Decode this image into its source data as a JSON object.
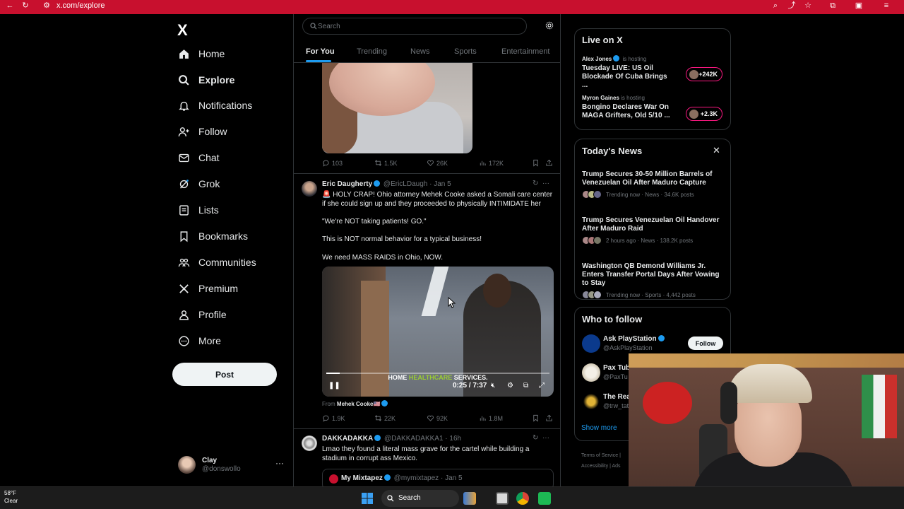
{
  "browser": {
    "url": "x.com/explore"
  },
  "nav": {
    "logo": "X",
    "items": [
      {
        "label": "Home",
        "icon": "home-icon"
      },
      {
        "label": "Explore",
        "icon": "search-icon"
      },
      {
        "label": "Notifications",
        "icon": "bell-icon"
      },
      {
        "label": "Follow",
        "icon": "person-add-icon"
      },
      {
        "label": "Chat",
        "icon": "envelope-icon"
      },
      {
        "label": "Grok",
        "icon": "grok-icon"
      },
      {
        "label": "Lists",
        "icon": "list-icon"
      },
      {
        "label": "Bookmarks",
        "icon": "bookmark-icon"
      },
      {
        "label": "Communities",
        "icon": "people-icon"
      },
      {
        "label": "Premium",
        "icon": "x-logo-icon"
      },
      {
        "label": "Profile",
        "icon": "person-icon"
      },
      {
        "label": "More",
        "icon": "more-circle-icon"
      }
    ],
    "post_label": "Post",
    "user": {
      "name": "Clay",
      "handle": "@donswollo",
      "more": "···"
    }
  },
  "center": {
    "search_placeholder": "Search",
    "tabs": [
      {
        "label": "For You",
        "active": true
      },
      {
        "label": "Trending"
      },
      {
        "label": "News"
      },
      {
        "label": "Sports"
      },
      {
        "label": "Entertainment"
      }
    ],
    "top_actions": {
      "replies": "103",
      "reposts": "1.5K",
      "likes": "26K",
      "views": "172K"
    },
    "tweet1": {
      "name": "Eric Daugherty",
      "handle": "@EricLDaugh",
      "date": "· Jan 5",
      "text1": "🚨 HOLY CRAP! Ohio attorney Mehek Cooke asked a Somali care center if she could sign up and they proceeded to physically INTIMIDATE her",
      "text2": "\"We're NOT taking patients! GO.\"",
      "text3": "This is NOT normal behavior for a typical business!",
      "text4": "We need MASS RAIDS in Ohio, NOW.",
      "video": {
        "caption_pre": "HOME ",
        "caption_hl": "HEALTHCARE",
        "caption_post": " SERVICES.",
        "time": "0:25 / 7:37",
        "progress": 0.06
      },
      "from_label": "From",
      "from_name": "Mehek Cooke🇺🇸",
      "actions": {
        "replies": "1.9K",
        "reposts": "22K",
        "likes": "92K",
        "views": "1.8M"
      }
    },
    "tweet2": {
      "name": "DAKKADAKKA",
      "handle": "@DAKKADAKKA1",
      "date": "· 16h",
      "text": "Lmao they found a literal mass grave for the cartel while building a stadium in corrupt ass Mexico.",
      "quote": {
        "name": "My Mixtapez",
        "handle": "@mymixtapez",
        "date": "· Jan 5"
      }
    }
  },
  "right": {
    "live": {
      "title": "Live on X",
      "items": [
        {
          "host": "Alex Jones",
          "hosting": "is hosting",
          "title": "Tuesday LIVE: US Oil Blockade Of Cuba Brings ...",
          "count": "+242K"
        },
        {
          "host": "Myron Gaines",
          "hosting": "is hosting",
          "title": "Bongino Declares War On MAGA Grifters, Old 5/10 ...",
          "count": "+2.3K"
        }
      ]
    },
    "news": {
      "title": "Today's News",
      "close": "✕",
      "items": [
        {
          "title": "Trump Secures 30-50 Million Barrels of Venezuelan Oil After Maduro Capture",
          "meta": "Trending now · News · 34.6K posts"
        },
        {
          "title": "Trump Secures Venezuelan Oil Handover After Maduro Raid",
          "meta": "2 hours ago · News · 138.2K posts"
        },
        {
          "title": "Washington QB Demond Williams Jr. Enters Transfer Portal Days After Vowing to Stay",
          "meta": "Trending now · Sports · 4,442 posts"
        }
      ]
    },
    "who": {
      "title": "Who to follow",
      "items": [
        {
          "name": "Ask PlayStation",
          "handle": "@AskPlayStation",
          "follow": "Follow"
        },
        {
          "name": "Pax Tub",
          "handle": "@PaxTu"
        },
        {
          "name": "The Rea",
          "handle": "@trw_tate"
        }
      ],
      "show_more": "Show more"
    },
    "footer": {
      "line1": "Terms of Service  |",
      "line2": "Accessibility  |  Ads"
    }
  },
  "taskbar": {
    "temp": "58°F",
    "cond": "Clear",
    "search": "Search"
  },
  "colors": {
    "accent": "#1d9bf0",
    "browser_bar": "#c8102e",
    "live_pill": "#f91880"
  }
}
